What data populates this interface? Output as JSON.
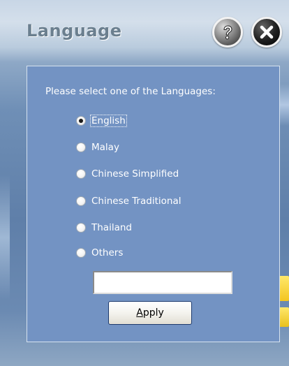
{
  "window": {
    "title": "Language"
  },
  "title_buttons": {
    "help_icon": "question-mark-icon",
    "close_icon": "close-x-icon"
  },
  "form": {
    "prompt": "Please select one of the Languages:",
    "options": [
      {
        "label": "English",
        "checked": true
      },
      {
        "label": "Malay",
        "checked": false
      },
      {
        "label": "Chinese Simplified",
        "checked": false
      },
      {
        "label": "Chinese Traditional",
        "checked": false
      },
      {
        "label": "Thailand",
        "checked": false
      },
      {
        "label": "Others",
        "checked": false
      }
    ],
    "other_input": {
      "value": "",
      "placeholder": ""
    },
    "apply_button": {
      "label_mnemonic": "A",
      "label_rest": "pply"
    }
  },
  "colors": {
    "panel": "#7393c3",
    "title_text": "#6b7f8f"
  }
}
